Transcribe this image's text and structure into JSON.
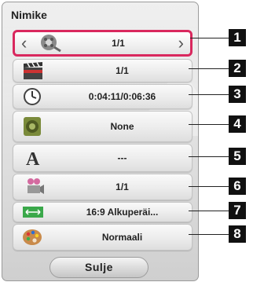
{
  "panel": {
    "title": "Nimike",
    "close_label": "Sulje"
  },
  "rows": [
    {
      "icon": "disc-title-icon",
      "value": "1/1",
      "callout": "1"
    },
    {
      "icon": "clapperboard-icon",
      "value": "1/1",
      "callout": "2"
    },
    {
      "icon": "clock-icon",
      "value": "0:04:11/0:06:36",
      "callout": "3"
    },
    {
      "icon": "speaker-icon",
      "value": "None",
      "callout": "4"
    },
    {
      "icon": "subtitle-a-icon",
      "value": "---",
      "callout": "5"
    },
    {
      "icon": "camera-angle-icon",
      "value": "1/1",
      "callout": "6"
    },
    {
      "icon": "aspect-ratio-icon",
      "value": "16:9 Alkuperäi...",
      "callout": "7"
    },
    {
      "icon": "palette-icon",
      "value": "Normaali",
      "callout": "8"
    }
  ],
  "nav": {
    "left": "‹",
    "right": "›"
  },
  "colors": {
    "selection": "#d9285e",
    "panel": "#dedede"
  }
}
